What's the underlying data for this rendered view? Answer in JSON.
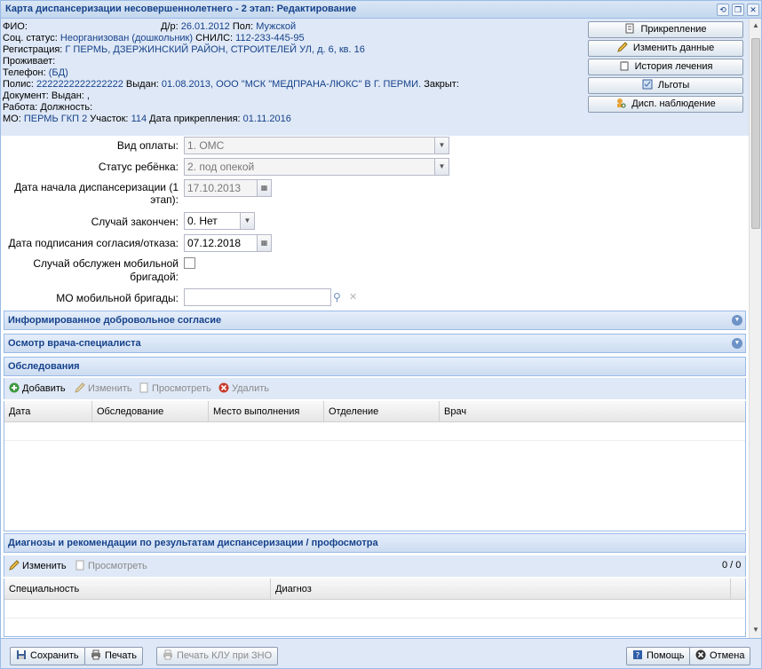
{
  "window": {
    "title": "Карта диспансеризации несовершеннолетнего - 2 этап: Редактирование"
  },
  "patient": {
    "fio_label": "ФИО:",
    "dob_label": "Д/р:",
    "dob": "26.01.2012",
    "sex_label": "Пол:",
    "sex": "Мужской",
    "social_label": "Соц. статус:",
    "social": "Неорганизован (дошкольник)",
    "snils_label": "СНИЛС:",
    "snils": "112-233-445-95",
    "registration_label": "Регистрация:",
    "registration": "Г ПЕРМЬ, ДЗЕРЖИНСКИЙ РАЙОН, СТРОИТЕЛЕЙ УЛ, д. 6, кв. 16",
    "lives_label": "Проживает:",
    "phone_label": "Телефон:",
    "phone": "(БД)",
    "polis_label": "Полис:",
    "polis": "2222222222222222",
    "issued_label": "Выдан:",
    "polis_issued": "01.08.2013, ООО \"МСК \"МЕДПРАНА-ЛЮКС\" В Г. ПЕРМИ.",
    "closed_label": "Закрыт:",
    "document_label": "Документ:",
    "document_issued": "Выдан: ,",
    "work_label": "Работа:",
    "position_label": "Должность:",
    "mo_label": "МО:",
    "mo": "ПЕРМЬ ГКП 2",
    "area_label": "Участок:",
    "area": "114",
    "attach_date_label": "Дата прикрепления:",
    "attach_date": "01.11.2016"
  },
  "side_buttons": {
    "attach": "Прикрепление",
    "edit_data": "Изменить данные",
    "history": "История лечения",
    "benefits": "Льготы",
    "disp": "Дисп. наблюдение"
  },
  "form": {
    "payment_label": "Вид оплаты:",
    "payment_value": "1. ОМС",
    "child_status_label": "Статус ребёнка:",
    "child_status_value": "2. под опекой",
    "start_date_label": "Дата начала диспансеризации (1 этап):",
    "start_date_value": "17.10.2013",
    "finished_label": "Случай закончен:",
    "finished_value": "0. Нет",
    "consent_date_label": "Дата подписания согласия/отказа:",
    "consent_date_value": "07.12.2018",
    "mobile_label": "Случай обслужен мобильной бригадой:",
    "mo_mobile_label": "МО мобильной бригады:",
    "mo_mobile_value": ""
  },
  "panels": {
    "consent": "Информированное добровольное согласие",
    "specialist": "Осмотр врача-специалиста",
    "exams": "Обследования",
    "diagnoses": "Диагнозы и рекомендации по результатам диспансеризации / профосмотра"
  },
  "exams_toolbar": {
    "add": "Добавить",
    "edit": "Изменить",
    "view": "Просмотреть",
    "delete": "Удалить"
  },
  "exams_columns": [
    "Дата",
    "Обследование",
    "Место выполнения",
    "Отделение",
    "Врач"
  ],
  "diag_toolbar": {
    "edit": "Изменить",
    "view": "Просмотреть",
    "counter": "0 / 0"
  },
  "diag_columns": [
    "Специальность",
    "Диагноз"
  ],
  "footer": {
    "save": "Сохранить",
    "print": "Печать",
    "print_klu": "Печать КЛУ при ЗНО",
    "help": "Помощь",
    "cancel": "Отмена"
  }
}
